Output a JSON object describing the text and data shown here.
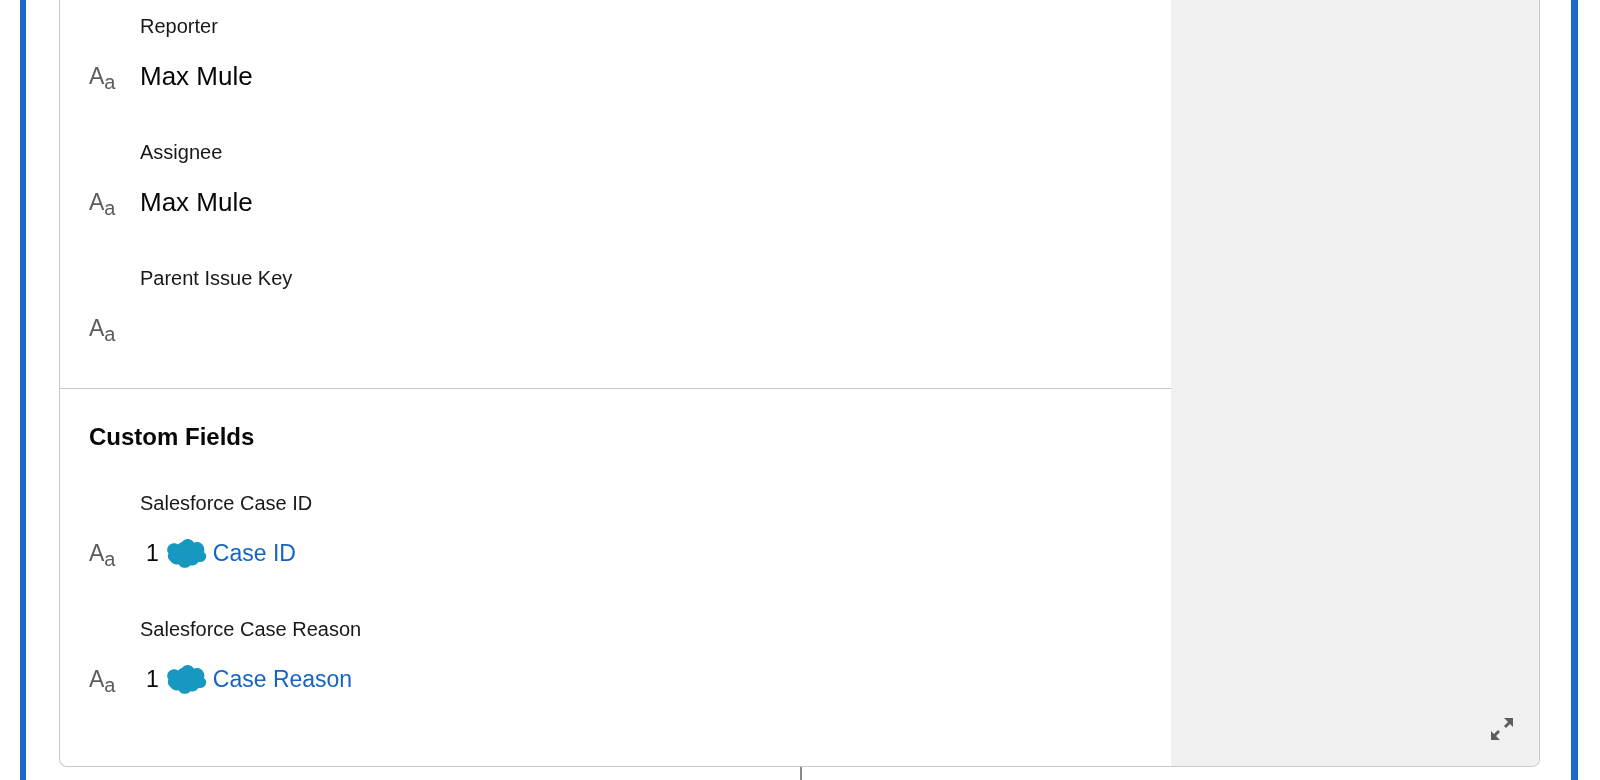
{
  "sections": [
    {
      "fields": [
        {
          "label": "Reporter",
          "type_icon": "A$_{a}$",
          "kind": "text",
          "value": "Max Mule"
        },
        {
          "label": "Assignee",
          "type_icon": "A$_{a}$",
          "kind": "text",
          "value": "Max Mule"
        },
        {
          "label": "Parent Issue Key",
          "type_icon": "A$_{a}$",
          "kind": "empty"
        }
      ]
    },
    {
      "heading": "Custom Fields",
      "fields": [
        {
          "label": "Salesforce Case ID",
          "type_icon": "A$_{a}$",
          "kind": "record_link",
          "count": "1",
          "link": "Case ID"
        },
        {
          "label": "Salesforce Case Reason",
          "type_icon": "A$_{a}$",
          "kind": "record_link",
          "count": "1",
          "link": "Case Reason"
        }
      ]
    }
  ]
}
